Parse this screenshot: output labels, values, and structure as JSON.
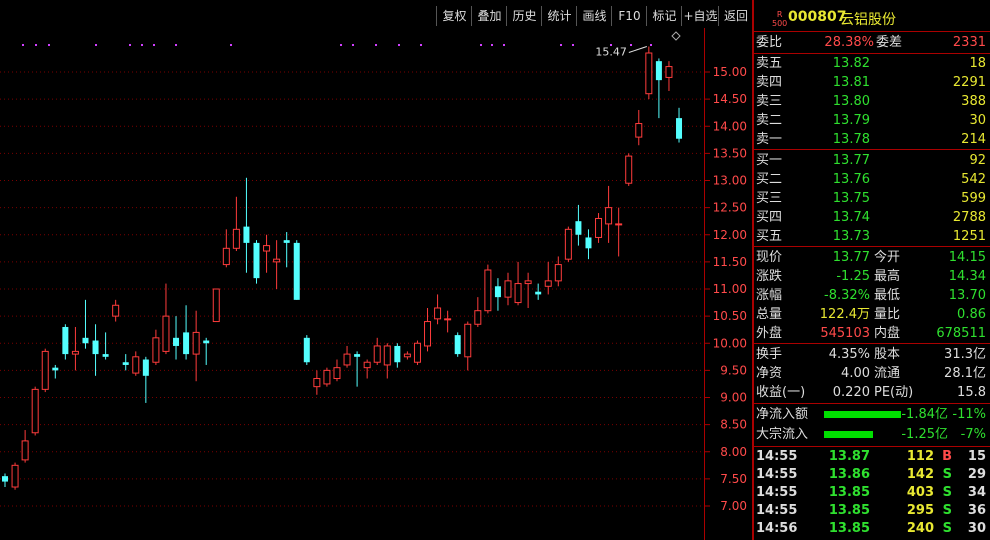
{
  "toolbar": {
    "buttons": [
      "复权",
      "叠加",
      "历史",
      "统计",
      "画线",
      "F10",
      "标记",
      "+自选",
      "返回"
    ]
  },
  "chart": {
    "annotation": "15.47",
    "price_ticks": [
      "15.00",
      "14.50",
      "14.00",
      "13.50",
      "13.00",
      "12.50",
      "12.00",
      "11.50",
      "11.00",
      "10.50",
      "10.00",
      "9.50",
      "9.00",
      "8.50",
      "8.00",
      "7.50",
      "7.00"
    ],
    "colors": {
      "up": "#ff3c3c",
      "down": "#54ffff",
      "grid": "#7a0000",
      "axis": "#aa0000",
      "dots": "#d040ff"
    }
  },
  "chart_data": {
    "type": "candlestick",
    "ylim": [
      6.7,
      15.7
    ],
    "candles": [
      {
        "o": 7.55,
        "c": 7.45,
        "h": 7.6,
        "l": 7.35
      },
      {
        "o": 7.35,
        "c": 7.75,
        "h": 7.8,
        "l": 7.3
      },
      {
        "o": 7.85,
        "c": 8.2,
        "h": 8.4,
        "l": 7.8
      },
      {
        "o": 8.35,
        "c": 9.15,
        "h": 9.2,
        "l": 8.3
      },
      {
        "o": 9.15,
        "c": 9.85,
        "h": 9.9,
        "l": 9.1
      },
      {
        "o": 9.55,
        "c": 9.5,
        "h": 9.6,
        "l": 9.35
      },
      {
        "o": 10.3,
        "c": 9.8,
        "h": 10.35,
        "l": 9.7
      },
      {
        "o": 9.8,
        "c": 9.85,
        "h": 10.3,
        "l": 9.5
      },
      {
        "o": 10.1,
        "c": 10.0,
        "h": 10.8,
        "l": 9.9
      },
      {
        "o": 10.05,
        "c": 9.8,
        "h": 10.35,
        "l": 9.4
      },
      {
        "o": 9.8,
        "c": 9.75,
        "h": 10.2,
        "l": 9.7
      },
      {
        "o": 10.5,
        "c": 10.7,
        "h": 10.8,
        "l": 10.4
      },
      {
        "o": 9.65,
        "c": 9.6,
        "h": 9.8,
        "l": 9.5
      },
      {
        "o": 9.45,
        "c": 9.75,
        "h": 9.85,
        "l": 9.4
      },
      {
        "o": 9.7,
        "c": 9.4,
        "h": 9.75,
        "l": 8.9
      },
      {
        "o": 9.65,
        "c": 10.1,
        "h": 10.25,
        "l": 9.6
      },
      {
        "o": 9.85,
        "c": 10.5,
        "h": 11.1,
        "l": 9.8
      },
      {
        "o": 10.1,
        "c": 9.95,
        "h": 10.5,
        "l": 9.7
      },
      {
        "o": 10.2,
        "c": 9.8,
        "h": 10.7,
        "l": 9.7
      },
      {
        "o": 9.8,
        "c": 10.2,
        "h": 10.6,
        "l": 9.3
      },
      {
        "o": 10.05,
        "c": 10.0,
        "h": 10.1,
        "l": 9.6
      },
      {
        "o": 10.4,
        "c": 11.0,
        "h": 11.0,
        "l": 10.4
      },
      {
        "o": 11.45,
        "c": 11.75,
        "h": 12.1,
        "l": 11.4
      },
      {
        "o": 11.75,
        "c": 12.1,
        "h": 12.7,
        "l": 11.7
      },
      {
        "o": 12.15,
        "c": 11.85,
        "h": 13.05,
        "l": 11.3
      },
      {
        "o": 11.85,
        "c": 11.2,
        "h": 11.9,
        "l": 11.1
      },
      {
        "o": 11.7,
        "c": 11.8,
        "h": 12.0,
        "l": 11.3
      },
      {
        "o": 11.5,
        "c": 11.55,
        "h": 11.9,
        "l": 11.0
      },
      {
        "o": 11.9,
        "c": 11.85,
        "h": 12.05,
        "l": 11.4
      },
      {
        "o": 11.85,
        "c": 10.8,
        "h": 11.9,
        "l": 10.8
      },
      {
        "o": 10.1,
        "c": 9.65,
        "h": 10.15,
        "l": 9.6
      },
      {
        "o": 9.2,
        "c": 9.35,
        "h": 9.5,
        "l": 9.05
      },
      {
        "o": 9.25,
        "c": 9.5,
        "h": 9.55,
        "l": 9.2
      },
      {
        "o": 9.35,
        "c": 9.55,
        "h": 9.7,
        "l": 9.3
      },
      {
        "o": 9.6,
        "c": 9.8,
        "h": 9.95,
        "l": 9.55
      },
      {
        "o": 9.8,
        "c": 9.75,
        "h": 9.85,
        "l": 9.2
      },
      {
        "o": 9.55,
        "c": 9.65,
        "h": 9.7,
        "l": 9.35
      },
      {
        "o": 9.65,
        "c": 9.95,
        "h": 10.1,
        "l": 9.6
      },
      {
        "o": 9.6,
        "c": 9.95,
        "h": 10.0,
        "l": 9.35
      },
      {
        "o": 9.95,
        "c": 9.65,
        "h": 10.0,
        "l": 9.55
      },
      {
        "o": 9.75,
        "c": 9.8,
        "h": 9.85,
        "l": 9.7
      },
      {
        "o": 9.65,
        "c": 10.0,
        "h": 10.05,
        "l": 9.6
      },
      {
        "o": 9.95,
        "c": 10.4,
        "h": 10.65,
        "l": 9.85
      },
      {
        "o": 10.45,
        "c": 10.65,
        "h": 10.9,
        "l": 10.35
      },
      {
        "o": 10.45,
        "c": 10.45,
        "h": 10.6,
        "l": 10.2
      },
      {
        "o": 10.15,
        "c": 9.8,
        "h": 10.2,
        "l": 9.75
      },
      {
        "o": 9.75,
        "c": 10.35,
        "h": 10.4,
        "l": 9.5
      },
      {
        "o": 10.35,
        "c": 10.6,
        "h": 10.85,
        "l": 10.3
      },
      {
        "o": 10.6,
        "c": 11.35,
        "h": 11.45,
        "l": 10.55
      },
      {
        "o": 11.05,
        "c": 10.85,
        "h": 11.2,
        "l": 10.6
      },
      {
        "o": 10.85,
        "c": 11.15,
        "h": 11.3,
        "l": 10.7
      },
      {
        "o": 10.75,
        "c": 11.1,
        "h": 11.5,
        "l": 10.7
      },
      {
        "o": 11.1,
        "c": 11.15,
        "h": 11.3,
        "l": 10.65
      },
      {
        "o": 10.95,
        "c": 10.9,
        "h": 11.1,
        "l": 10.8
      },
      {
        "o": 11.05,
        "c": 11.15,
        "h": 11.5,
        "l": 10.9
      },
      {
        "o": 11.15,
        "c": 11.45,
        "h": 11.6,
        "l": 11.05
      },
      {
        "o": 11.55,
        "c": 12.1,
        "h": 12.15,
        "l": 11.5
      },
      {
        "o": 12.25,
        "c": 12.0,
        "h": 12.55,
        "l": 11.8
      },
      {
        "o": 11.95,
        "c": 11.75,
        "h": 12.1,
        "l": 11.55
      },
      {
        "o": 11.95,
        "c": 12.3,
        "h": 12.4,
        "l": 11.85
      },
      {
        "o": 12.2,
        "c": 12.5,
        "h": 12.9,
        "l": 11.85
      },
      {
        "o": 12.2,
        "c": 12.2,
        "h": 12.5,
        "l": 11.6
      },
      {
        "o": 12.95,
        "c": 13.45,
        "h": 13.5,
        "l": 12.9
      },
      {
        "o": 13.8,
        "c": 14.05,
        "h": 14.3,
        "l": 13.65
      },
      {
        "o": 14.6,
        "c": 15.35,
        "h": 15.47,
        "l": 14.5
      },
      {
        "o": 15.2,
        "c": 14.85,
        "h": 15.25,
        "l": 14.15
      },
      {
        "o": 14.9,
        "c": 15.1,
        "h": 15.2,
        "l": 14.65
      },
      {
        "o": 14.15,
        "c": 13.77,
        "h": 14.34,
        "l": 13.7
      }
    ]
  },
  "panel": {
    "code": "000807",
    "name": "云铝股份",
    "badge_r": "R",
    "badge_num": "500",
    "webi": {
      "label": "委比",
      "value": "28.38%",
      "label2": "委差",
      "value2": "2331"
    },
    "asks": [
      {
        "label": "卖五",
        "price": "13.82",
        "vol": "18"
      },
      {
        "label": "卖四",
        "price": "13.81",
        "vol": "2291"
      },
      {
        "label": "卖三",
        "price": "13.80",
        "vol": "388"
      },
      {
        "label": "卖二",
        "price": "13.79",
        "vol": "30"
      },
      {
        "label": "卖一",
        "price": "13.78",
        "vol": "214"
      }
    ],
    "bids": [
      {
        "label": "买一",
        "price": "13.77",
        "vol": "92"
      },
      {
        "label": "买二",
        "price": "13.76",
        "vol": "542"
      },
      {
        "label": "买三",
        "price": "13.75",
        "vol": "599"
      },
      {
        "label": "买四",
        "price": "13.74",
        "vol": "2788"
      },
      {
        "label": "买五",
        "price": "13.73",
        "vol": "1251"
      }
    ],
    "stats": [
      {
        "l1": "现价",
        "v1": "13.77",
        "c1": "green",
        "l2": "今开",
        "v2": "14.15",
        "c2": "green"
      },
      {
        "l1": "涨跌",
        "v1": "-1.25",
        "c1": "green",
        "l2": "最高",
        "v2": "14.34",
        "c2": "green"
      },
      {
        "l1": "涨幅",
        "v1": "-8.32%",
        "c1": "green",
        "l2": "最低",
        "v2": "13.70",
        "c2": "green"
      },
      {
        "l1": "总量",
        "v1": "122.4万",
        "c1": "yellow",
        "l2": "量比",
        "v2": "0.86",
        "c2": "green"
      },
      {
        "l1": "外盘",
        "v1": "545103",
        "c1": "red",
        "l2": "内盘",
        "v2": "678511",
        "c2": "green"
      }
    ],
    "fund": [
      {
        "l1": "换手",
        "v1": "4.35%",
        "l2": "股本",
        "v2": "31.3亿"
      },
      {
        "l1": "净资",
        "v1": "4.00",
        "l2": "流通",
        "v2": "28.1亿"
      },
      {
        "l1": "收益(一)",
        "v1": "0.220",
        "l2": "PE(动)",
        "v2": "15.8"
      }
    ],
    "flows": [
      {
        "label": "净流入额",
        "amount": "-1.84亿",
        "pct": "-11%",
        "bar": 0.11
      },
      {
        "label": "大宗流入",
        "amount": "-1.25亿",
        "pct": "-7%",
        "bar": 0.07
      }
    ],
    "ticks": [
      {
        "time": "14:55",
        "price": "13.87",
        "vol": "112",
        "side": "B",
        "n": "15"
      },
      {
        "time": "14:55",
        "price": "13.86",
        "vol": "142",
        "side": "S",
        "n": "29"
      },
      {
        "time": "14:55",
        "price": "13.85",
        "vol": "403",
        "side": "S",
        "n": "34"
      },
      {
        "time": "14:55",
        "price": "13.85",
        "vol": "295",
        "side": "S",
        "n": "36"
      },
      {
        "time": "14:56",
        "price": "13.85",
        "vol": "240",
        "side": "S",
        "n": "30"
      }
    ]
  }
}
